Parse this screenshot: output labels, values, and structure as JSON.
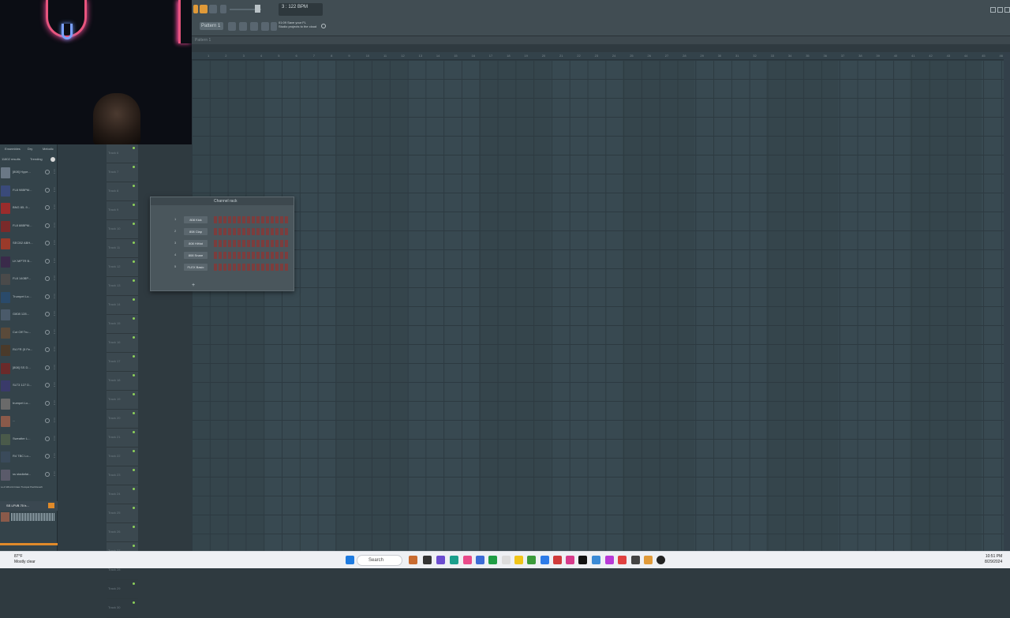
{
  "toolbar": {
    "tempo_display": "3 : 122 BPM",
    "pattern_label": "Pattern 1",
    "hint_line1": "01:09  Save your FL",
    "hint_line2": "Studio projects to the cloud"
  },
  "playlist": {
    "title": "Pattern 1",
    "ruler_marks": [
      "1",
      "2",
      "3",
      "4",
      "5",
      "6",
      "7",
      "8",
      "9",
      "10",
      "11",
      "12",
      "13",
      "14",
      "15",
      "16",
      "17",
      "18",
      "19",
      "20",
      "21",
      "22",
      "23",
      "24",
      "25",
      "26",
      "27",
      "28",
      "29",
      "30",
      "31",
      "32",
      "33",
      "34",
      "35",
      "36",
      "37",
      "38",
      "39",
      "40",
      "41",
      "42",
      "43",
      "44",
      "45",
      "46"
    ]
  },
  "browser": {
    "tabs": [
      "Ensembles",
      "Dry",
      "Melodic"
    ],
    "results": "11802 results",
    "sort": "Trending",
    "items": [
      {
        "label": "[808] Hype...",
        "color": "#6a7886"
      },
      {
        "label": "FL8 98BPM...",
        "color": "#3a4a7a"
      },
      {
        "label": "BNG 85..9...",
        "color": "#9a2c2c"
      },
      {
        "label": "FL8 88BPM...",
        "color": "#7a2a2a"
      },
      {
        "label": "SECB2 ABH...",
        "color": "#9a3a2a"
      },
      {
        "label": "LK MPTR B...",
        "color": "#3a2a4a"
      },
      {
        "label": "FL8 140BP...",
        "color": "#4a4a4a"
      },
      {
        "label": "Trumpet Lo...",
        "color": "#2a4a6a"
      },
      {
        "label": "G808 128...",
        "color": "#4a5a6a"
      },
      {
        "label": "Cut Off Tru...",
        "color": "#5a4a3a"
      },
      {
        "label": "R4 FR (5 Fe...",
        "color": "#4a3a2a"
      },
      {
        "label": "[808] SS D...",
        "color": "#6a2a2a"
      },
      {
        "label": "SLT3 127 D...",
        "color": "#3a3a6a"
      },
      {
        "label": "trumpet Lo...",
        "color": "#6a6a6a"
      },
      {
        "label": "...",
        "color": "#8a5a4a"
      },
      {
        "label": "Sweatter L...",
        "color": "#4a5a4a"
      },
      {
        "label": "R4 TBC Lo...",
        "color": "#3a4a5a"
      },
      {
        "label": "ss stadiafai...",
        "color": "#5a5a6a"
      }
    ],
    "footer_tags": [
      "Lo-fi",
      "Wind & brass",
      "Trumpet",
      "Pad",
      "Reverb"
    ],
    "preview_title": "SS LFVB 70 h..."
  },
  "tracks": [
    "Track 6",
    "Track 7",
    "Track 8",
    "Track 9",
    "Track 10",
    "Track 11",
    "Track 12",
    "Track 13",
    "Track 14",
    "Track 15",
    "Track 16",
    "Track 17",
    "Track 18",
    "Track 19",
    "Track 20",
    "Track 21",
    "Track 22",
    "Track 23",
    "Track 24",
    "Track 25",
    "Track 26",
    "Track 27",
    "Track 28",
    "Track 29",
    "Track 30"
  ],
  "channel_rack": {
    "title": "Channel rack",
    "channels": [
      {
        "num": "1",
        "name": "808 Kick"
      },
      {
        "num": "2",
        "name": "808 Clap"
      },
      {
        "num": "3",
        "name": "808 HiHat"
      },
      {
        "num": "4",
        "name": "808 Snare"
      },
      {
        "num": "5",
        "name": "FLEX Basic"
      }
    ],
    "add_label": "+"
  },
  "taskbar": {
    "search_placeholder": "Search",
    "time": "10:51 PM",
    "date": "8/29/2024",
    "weather_temp": "87°F",
    "weather_desc": "Mostly clear"
  }
}
